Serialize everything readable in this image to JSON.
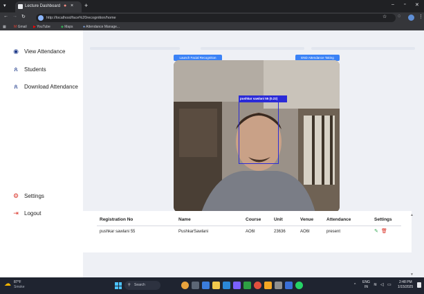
{
  "browser": {
    "tab_title": "Lecture Dashboard",
    "url": "http://localhost/face%20recognition/home",
    "bookmarks": [
      "Gmail",
      "YouTube",
      "Maps",
      "Attendance Manage..."
    ]
  },
  "sidebar": {
    "items": [
      {
        "label": "View Attendance",
        "icon": "eye-icon"
      },
      {
        "label": "Students",
        "icon": "person-icon"
      },
      {
        "label": "Download Attendance",
        "icon": "person-icon"
      },
      {
        "label": "Settings",
        "icon": "gear-icon"
      },
      {
        "label": "Logout",
        "icon": "logout-icon"
      }
    ]
  },
  "main": {
    "launch_button": "Launch Facial Recognition",
    "end_button": "END Attendance Taking",
    "detection_label": "pushkar sawlani 55 (0.22)"
  },
  "table": {
    "headers": [
      "Registration No",
      "Name",
      "Course",
      "Unit",
      "Venue",
      "Attendance",
      "Settings"
    ],
    "rows": [
      [
        "pushkar sawlani 55",
        "PushkarSawlani",
        "AO6I",
        "23636",
        "AO6I",
        "present"
      ]
    ]
  },
  "taskbar": {
    "weather_temp": "87°F",
    "weather_desc": "Smoke",
    "search_placeholder": "Search",
    "lang_top": "ENG",
    "lang_bottom": "IN",
    "time": "2:48 PM",
    "date": "1/15/2025"
  },
  "colors": {
    "accent_blue": "#3b82f6",
    "nav_icon": "#1e3a8a",
    "danger": "#d93025",
    "detection_box": "#2a2ad8"
  }
}
